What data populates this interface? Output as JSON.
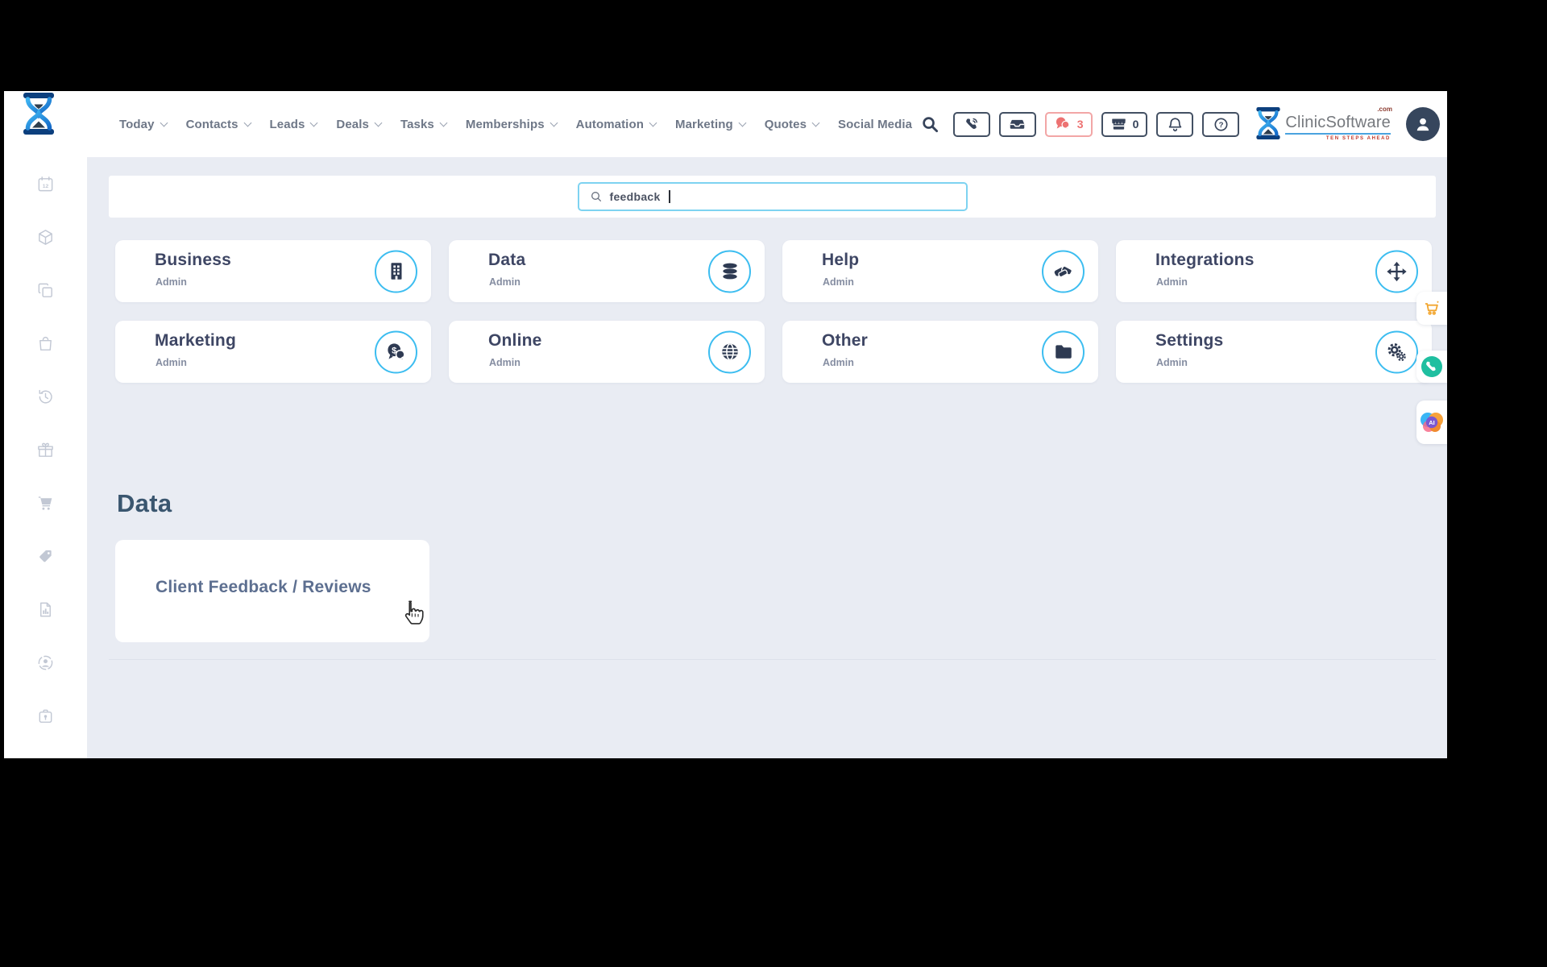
{
  "nav": {
    "items": [
      {
        "label": "Today",
        "caret": true
      },
      {
        "label": "Contacts",
        "caret": true
      },
      {
        "label": "Leads",
        "caret": true
      },
      {
        "label": "Deals",
        "caret": true
      },
      {
        "label": "Tasks",
        "caret": true
      },
      {
        "label": "Memberships",
        "caret": true
      },
      {
        "label": "Automation",
        "caret": true
      },
      {
        "label": "Marketing",
        "caret": true
      },
      {
        "label": "Quotes",
        "caret": true
      },
      {
        "label": "Social Media",
        "caret": false
      }
    ]
  },
  "header": {
    "messages_count": "3",
    "store_count": "0",
    "logo": {
      "brand": "ClinicSoftware",
      "tld": ".com",
      "tagline": "TEN STEPS AHEAD"
    }
  },
  "search": {
    "value": "feedback"
  },
  "categories": [
    {
      "title": "Business",
      "subtitle": "Admin",
      "icon": "building-icon"
    },
    {
      "title": "Data",
      "subtitle": "Admin",
      "icon": "database-icon"
    },
    {
      "title": "Help",
      "subtitle": "Admin",
      "icon": "handshake-icon"
    },
    {
      "title": "Integrations",
      "subtitle": "Admin",
      "icon": "move-arrows-icon"
    },
    {
      "title": "Marketing",
      "subtitle": "Admin",
      "icon": "chat-dollar-icon"
    },
    {
      "title": "Online",
      "subtitle": "Admin",
      "icon": "globe-icon"
    },
    {
      "title": "Other",
      "subtitle": "Admin",
      "icon": "folder-icon"
    },
    {
      "title": "Settings",
      "subtitle": "Admin",
      "icon": "gears-icon"
    }
  ],
  "results": {
    "heading": "Data",
    "items": [
      {
        "title": "Client Feedback / Reviews"
      }
    ]
  },
  "floating": {
    "ai_label": "AI"
  },
  "colors": {
    "accent_blue": "#3cbdf0",
    "navy": "#36435a",
    "alert_red": "#ed7272",
    "orange": "#f2a630",
    "teal": "#1fbfa0",
    "content_bg": "#e9ecf3"
  }
}
